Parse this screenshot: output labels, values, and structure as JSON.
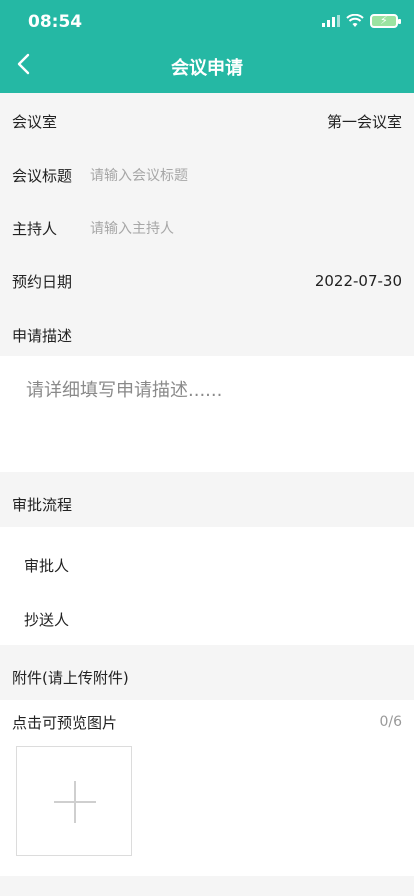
{
  "status": {
    "time": "08:54"
  },
  "header": {
    "title": "会议申请"
  },
  "form": {
    "room_label": "会议室",
    "room_value": "第一会议室",
    "title_label": "会议标题",
    "title_placeholder": "请输入会议标题",
    "host_label": "主持人",
    "host_placeholder": "请输入主持人",
    "date_label": "预约日期",
    "date_value": "2022-07-30",
    "desc_label": "申请描述",
    "desc_placeholder": "请详细填写申请描述......"
  },
  "approval": {
    "section_label": "审批流程",
    "approver_label": "审批人",
    "cc_label": "抄送人"
  },
  "attachments": {
    "section_label": "附件(请上传附件)",
    "preview_label": "点击可预览图片",
    "counter": "0/6"
  },
  "icons": {
    "back": "chevron-left-icon",
    "add": "plus-icon",
    "signal": "cellular-signal-icon",
    "wifi": "wifi-icon",
    "battery": "battery-charging-icon"
  },
  "colors": {
    "accent": "#25b8a4",
    "background": "#f5f5f5"
  }
}
